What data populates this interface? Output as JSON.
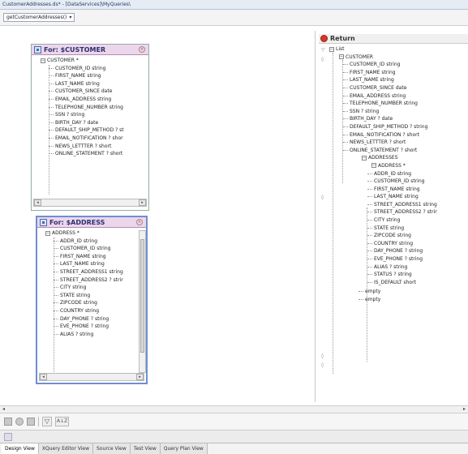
{
  "window": {
    "title": "CustomerAddresses.ds* - [DataServices]\\MyQueries\\"
  },
  "query_select": {
    "value": "getCustomerAddresses()"
  },
  "customer_panel": {
    "title": "For: $CUSTOMER",
    "root": "CUSTOMER *",
    "fields": [
      "CUSTOMER_ID  string",
      "FIRST_NAME  string",
      "LAST_NAME  string",
      "CUSTOMER_SINCE  date",
      "EMAIL_ADDRESS  string",
      "TELEPHONE_NUMBER  string",
      "SSN ?  string",
      "BIRTH_DAY ?  date",
      "DEFAULT_SHIP_METHOD ?  st",
      "EMAIL_NOTIFICATION ?  shor",
      "NEWS_LETTTER ?  short",
      "ONLINE_STATEMENT ?  short"
    ]
  },
  "address_panel": {
    "title": "For: $ADDRESS",
    "root": "ADDRESS *",
    "fields": [
      "ADDR_ID  string",
      "CUSTOMER_ID  string",
      "FIRST_NAME  string",
      "LAST_NAME  string",
      "STREET_ADDRESS1  string",
      "STREET_ADDRESS2 ?  strir",
      "CITY  string",
      "STATE  string",
      "ZIPCODE  string",
      "COUNTRY  string",
      "DAY_PHONE ?  string",
      "EVE_PHONE ?  string",
      "ALIAS ?  string"
    ]
  },
  "return_panel": {
    "title": "Return",
    "list_label": "List",
    "customer_root": "CUSTOMER",
    "customer_fields": [
      "CUSTOMER_ID  string",
      "FIRST_NAME  string",
      "LAST_NAME  string",
      "CUSTOMER_SINCE  date",
      "EMAIL_ADDRESS  string",
      "TELEPHONE_NUMBER  string",
      "SSN ?  string",
      "BIRTH_DAY ?  date",
      "DEFAULT_SHIP_METHOD ?  string",
      "EMAIL_NOTIFICATION ?  short",
      "NEWS_LETTTER ?  short",
      "ONLINE_STATEMENT ?  short"
    ],
    "addresses_label": "ADDRESSES",
    "address_root": "ADDRESS *",
    "address_fields": [
      "ADDR_ID  string",
      "CUSTOMER_ID  string",
      "FIRST_NAME  string",
      "LAST_NAME  string",
      "STREET_ADDRESS1  string",
      "STREET_ADDRESS2 ?  strir",
      "CITY  string",
      "STATE  string",
      "ZIPCODE  string",
      "COUNTRY  string",
      "DAY_PHONE ?  string",
      "EVE_PHONE ?  string",
      "ALIAS ?  string",
      "STATUS ?  string",
      "IS_DEFAULT  short"
    ],
    "empty_1": "empty",
    "empty_2": "empty"
  },
  "toolbar": {
    "sort_label": "A↓Z"
  },
  "tabs": [
    "Design View",
    "XQuery Editor View",
    "Source View",
    "Test View",
    "Query Plan View"
  ],
  "icons": {
    "panel": "schema-icon",
    "return": "return-icon",
    "clear": "close-icon",
    "filter": "funnel-icon",
    "sort": "sort-icon"
  },
  "colors": {
    "panel_header": "#ecd6ec",
    "return_icon": "#d43a2a",
    "selected_border": "#6f8fd0"
  }
}
